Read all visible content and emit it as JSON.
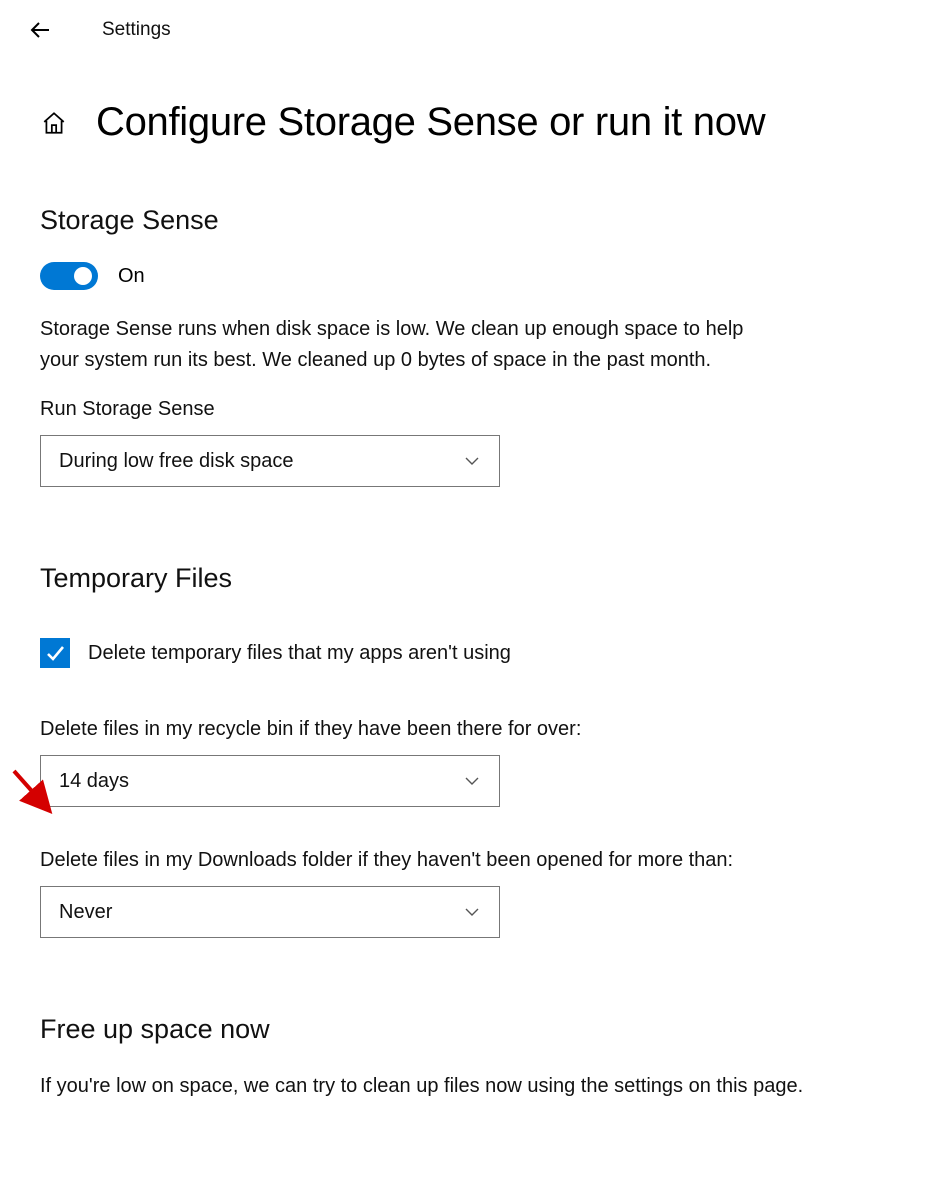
{
  "header": {
    "title": "Settings"
  },
  "page": {
    "title": "Configure Storage Sense or run it now"
  },
  "storage_sense": {
    "heading": "Storage Sense",
    "toggle_label": "On",
    "description": "Storage Sense runs when disk space is low. We clean up enough space to help your system run its best. We cleaned up 0 bytes of space in the past month.",
    "run_label": "Run Storage Sense",
    "run_value": "During low free disk space"
  },
  "temporary_files": {
    "heading": "Temporary Files",
    "checkbox_label": "Delete temporary files that my apps aren't using",
    "recycle_label": "Delete files in my recycle bin if they have been there for over:",
    "recycle_value": "14 days",
    "downloads_label": "Delete files in my Downloads folder if they haven't been opened for more than:",
    "downloads_value": "Never"
  },
  "free_up": {
    "heading": "Free up space now",
    "description": "If you're low on space, we can try to clean up files now using the settings on this page."
  }
}
